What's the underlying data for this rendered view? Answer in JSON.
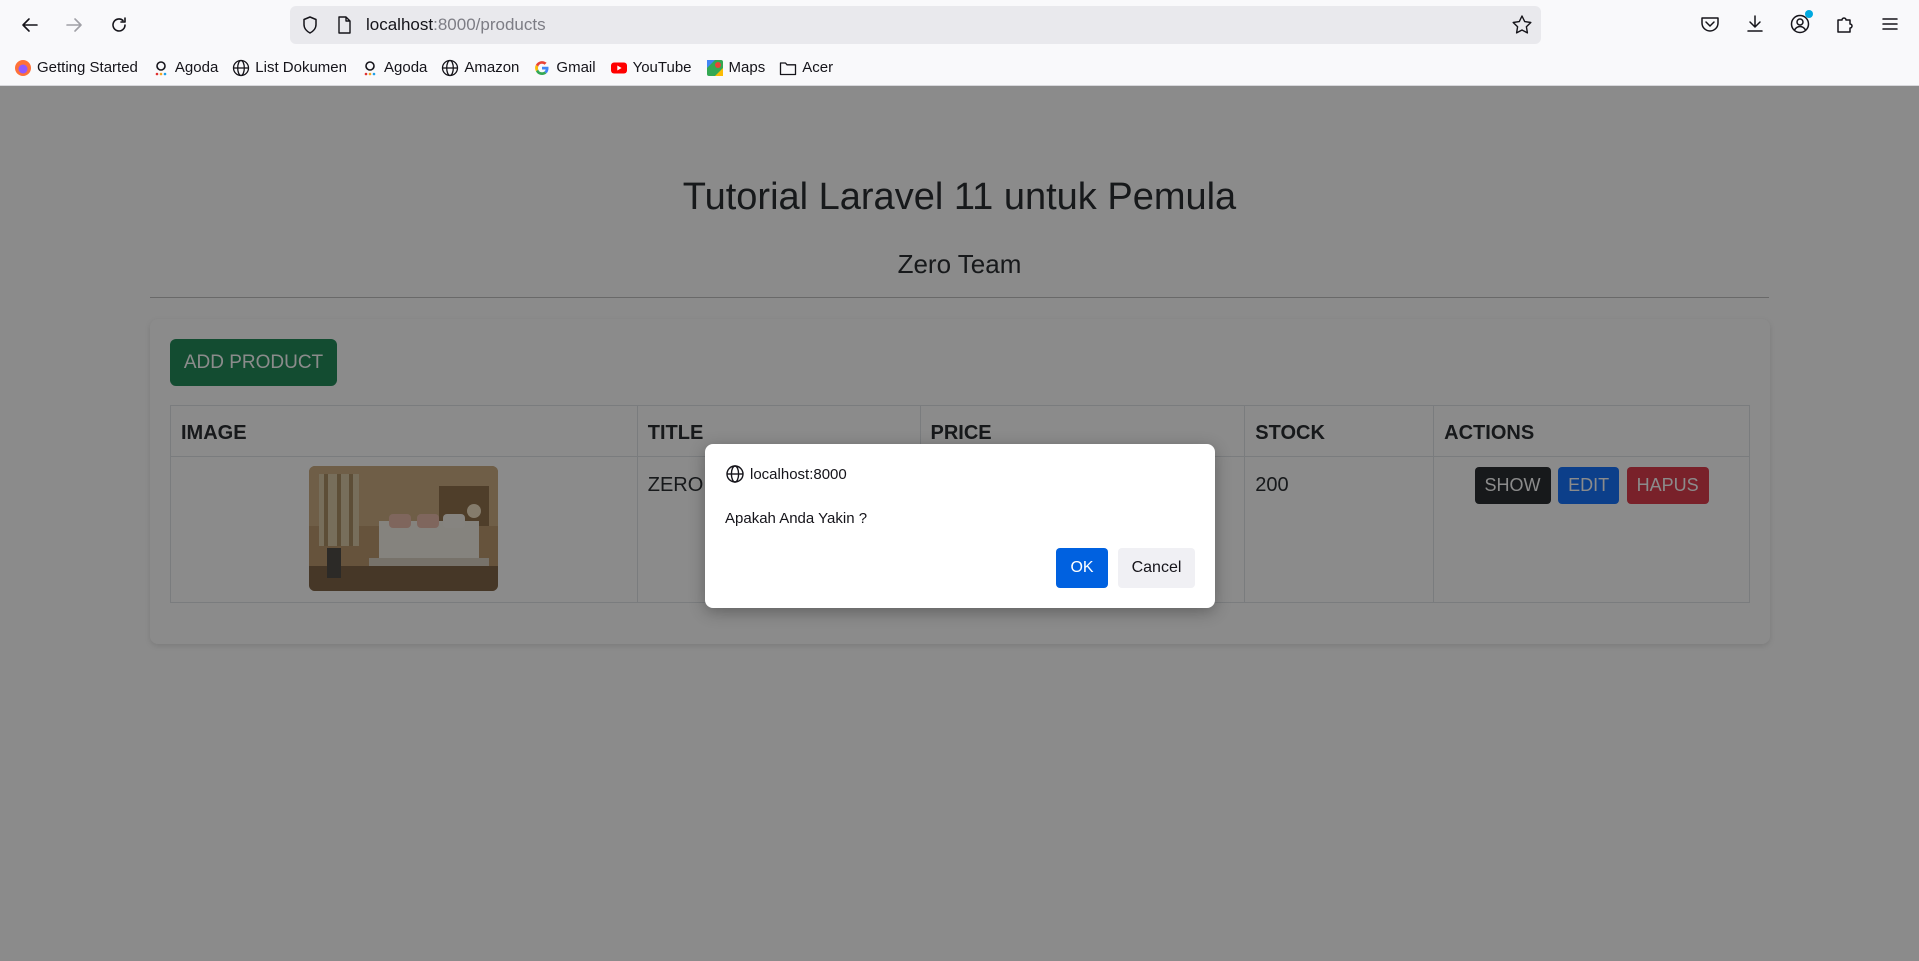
{
  "browser": {
    "url_host": "localhost",
    "url_rest": ":8000/products",
    "bookmarks": [
      {
        "label": "Getting Started",
        "icon": "firefox-icon"
      },
      {
        "label": "Agoda",
        "icon": "agoda-icon"
      },
      {
        "label": "List Dokumen",
        "icon": "globe-icon"
      },
      {
        "label": "Agoda",
        "icon": "agoda-icon"
      },
      {
        "label": "Amazon",
        "icon": "globe-icon"
      },
      {
        "label": "Gmail",
        "icon": "google-icon"
      },
      {
        "label": "YouTube",
        "icon": "youtube-icon"
      },
      {
        "label": "Maps",
        "icon": "maps-icon"
      },
      {
        "label": "Acer",
        "icon": "folder-icon"
      }
    ]
  },
  "page": {
    "title": "Tutorial Laravel 11 untuk Pemula",
    "subtitle": "Zero Team",
    "add_button": "ADD PRODUCT",
    "table": {
      "headers": [
        "IMAGE",
        "TITLE",
        "PRICE",
        "STOCK",
        "ACTIONS"
      ],
      "rows": [
        {
          "title": "ZERO T",
          "price": "",
          "stock": "200",
          "image": "hotel-room-photo"
        }
      ]
    },
    "actions": {
      "show": "SHOW",
      "edit": "EDIT",
      "delete": "HAPUS"
    }
  },
  "dialog": {
    "origin": "localhost:8000",
    "message": "Apakah Anda Yakin ?",
    "ok": "OK",
    "cancel": "Cancel"
  },
  "colors": {
    "add_button": "#198754",
    "show_button": "#212529",
    "edit_button": "#0d6efd",
    "delete_button": "#dc3545",
    "dialog_ok": "#0061e0"
  }
}
